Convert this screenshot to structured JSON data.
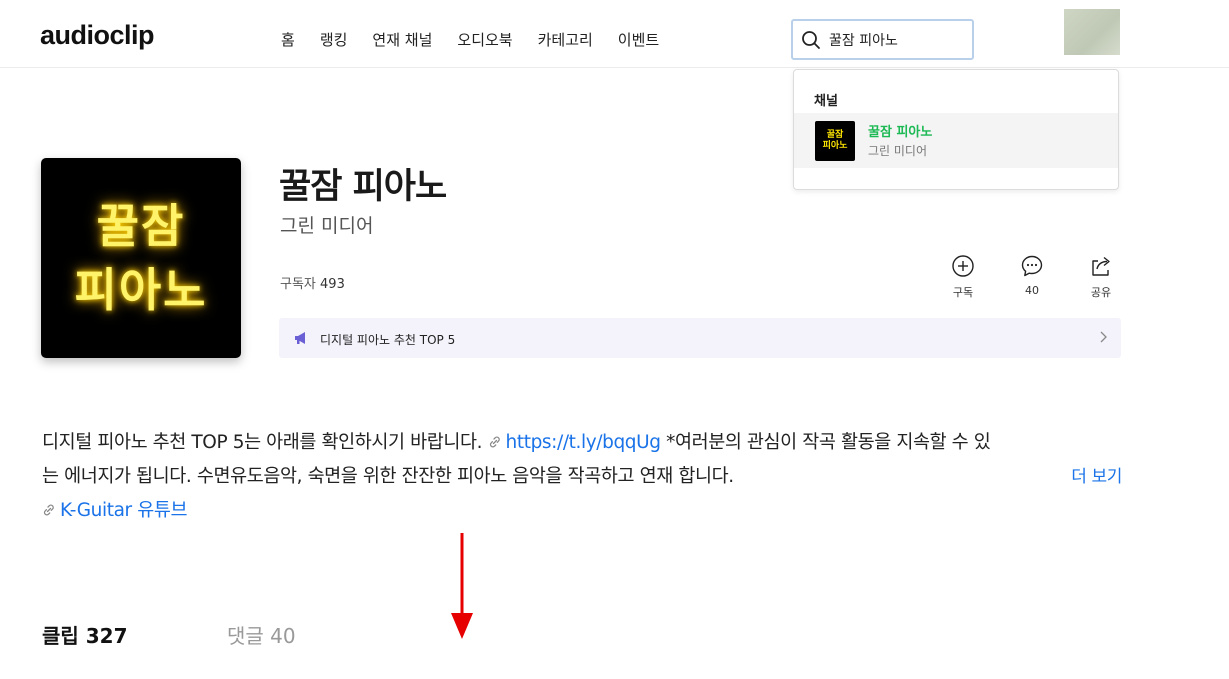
{
  "header": {
    "logo": "audioclip",
    "nav": [
      "홈",
      "랭킹",
      "연재 채널",
      "오디오북",
      "카테고리",
      "이벤트"
    ],
    "search_value": "꿀잠 피아노"
  },
  "search_dropdown": {
    "section_title": "채널",
    "result": {
      "thumb_line1": "꿀잠",
      "thumb_line2": "피아노",
      "title": "꿀잠 피아노",
      "subtitle": "그린 미디어"
    }
  },
  "channel": {
    "cover_line1": "꿀잠",
    "cover_line2": "피아노",
    "title": "꿀잠 피아노",
    "author": "그린 미디어",
    "subscribers_label": "구독자",
    "subscribers_count": "493",
    "actions": {
      "subscribe": "구독",
      "comments": "40",
      "share": "공유"
    },
    "notice": "디지털 피아노 추천 TOP 5"
  },
  "description": {
    "line1_text": "디지털 피아노 추천 TOP 5는 아래를 확인하시기 바랍니다.",
    "line1_link": "https://t.ly/bqqUg",
    "line1_tail": " *여러분의 관심이 작곡 활동을 지속할 수 있",
    "line2_text": "는 에너지가 됩니다. 수면유도음악, 숙면을 위한 잔잔한 피아노 음악을 작곡하고 연재 합니다.",
    "more": "더 보기",
    "line3_link": "K-Guitar 유튜브"
  },
  "tabs": {
    "clips": "클립 327",
    "comments": "댓글 40"
  },
  "colors": {
    "accent_link": "#1a73e8",
    "search_result_title": "#1db954",
    "annotation_arrow": "#e60000"
  }
}
